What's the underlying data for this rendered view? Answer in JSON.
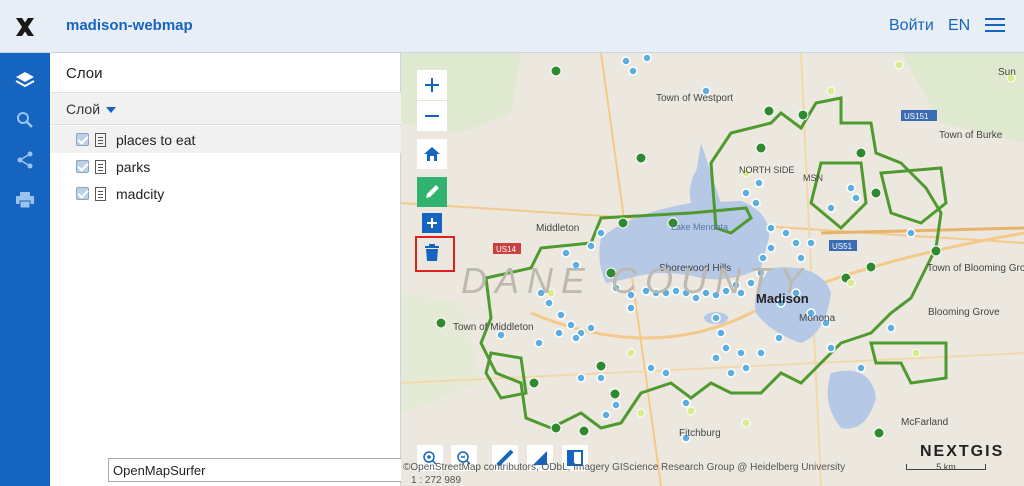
{
  "header": {
    "app_title": "madison-webmap",
    "login_label": "Войти",
    "lang_label": "EN",
    "logo_icon": "x-logo-icon",
    "menu_icon": "hamburger-icon"
  },
  "nav": {
    "items": [
      {
        "icon": "layers-icon"
      },
      {
        "icon": "search-icon"
      },
      {
        "icon": "share-icon"
      },
      {
        "icon": "print-icon"
      }
    ]
  },
  "panel": {
    "title": "Слои",
    "layer_header": "Слой",
    "layers": [
      {
        "label": "places to eat",
        "checked": true
      },
      {
        "label": "parks",
        "checked": true
      },
      {
        "label": "madcity",
        "checked": true
      }
    ],
    "basemap": "OpenMapSurfer"
  },
  "map": {
    "attribution": "©OpenStreetMap contributors, ODbL, Imagery GIScience Research Group @ Heidelberg University",
    "scale": "1 : 272 989",
    "scalebar_label": "5 km",
    "brand": "NEXTGIS",
    "place_labels": [
      "Town of Westport",
      "Town of Burke",
      "Middleton",
      "Shorewood Hills",
      "Madison",
      "Monona",
      "Town of Middleton",
      "Town of Blooming Grove",
      "Blooming Grove",
      "Fitchburg",
      "McFarland",
      "MSN",
      "NORTH SIDE",
      "Lake Mendota",
      "Sun",
      "US151",
      "US14",
      "US51"
    ],
    "tools": [
      {
        "icon": "zoom-in-icon"
      },
      {
        "icon": "zoom-out-icon"
      },
      {
        "icon": "home-icon"
      },
      {
        "icon": "edit-pencil-icon"
      },
      {
        "icon": "add-feature-icon"
      },
      {
        "icon": "delete-trash-icon"
      },
      {
        "icon": "zoom-in-box-icon"
      },
      {
        "icon": "zoom-out-box-icon"
      },
      {
        "icon": "measure-distance-icon"
      },
      {
        "icon": "measure-area-icon"
      },
      {
        "icon": "identify-icon"
      }
    ],
    "colors": {
      "water": "#b5c9e6",
      "boundary": "#4f9a2e",
      "point_blue": "#5aaee0",
      "point_dark": "#2f8a2f",
      "point_light": "#cfe68a"
    }
  }
}
